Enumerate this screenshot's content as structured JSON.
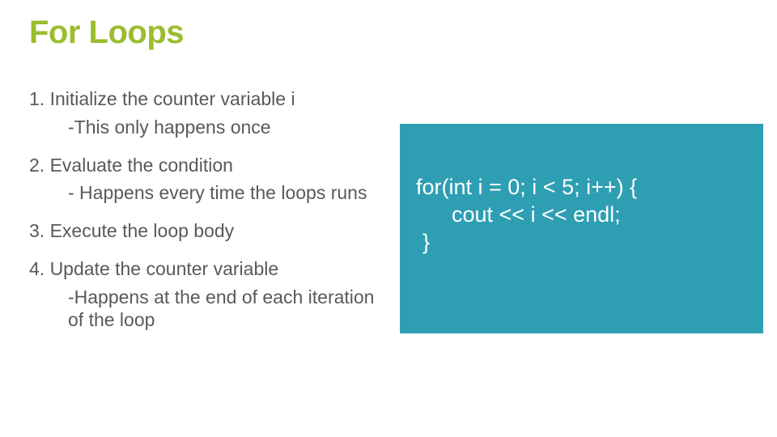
{
  "title": "For Loops",
  "steps": {
    "s1": "1. Initialize the counter variable i",
    "s1sub": "-This only happens once",
    "s2": "2. Evaluate the condition",
    "s2sub": "- Happens every time the loops runs",
    "s3": "3. Execute the loop body",
    "s4": "4. Update the counter variable",
    "s4sub": "-Happens at the end of each iteration of the loop"
  },
  "code": {
    "line1": "for(int i = 0; i < 5; i++) {",
    "line2": "cout << i << endl;",
    "line3": "}"
  }
}
